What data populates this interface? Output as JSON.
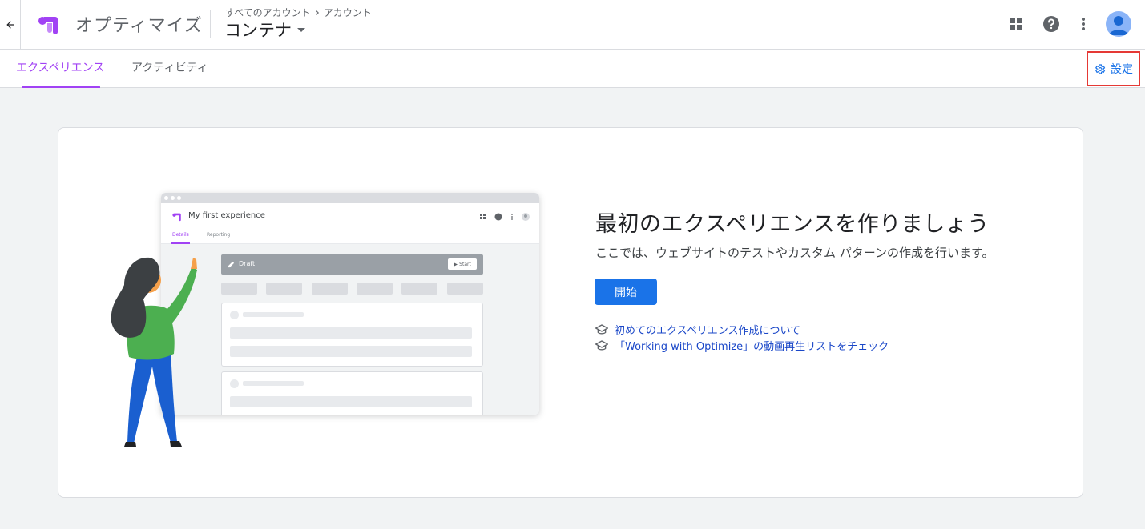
{
  "app": {
    "name": "オプティマイズ",
    "breadcrumb": [
      "すべてのアカウント",
      "アカウント"
    ],
    "container_name": "コンテナ"
  },
  "header_icons": [
    "apps-grid-icon",
    "help-icon",
    "more-vert-icon",
    "account-avatar"
  ],
  "tabs": [
    {
      "label": "エクスペリエンス",
      "active": true
    },
    {
      "label": "アクティビティ",
      "active": false
    }
  ],
  "settings": {
    "label": "設定"
  },
  "illustration": {
    "window_title": "My first experience",
    "tabs": [
      "Details",
      "Reporting"
    ],
    "draft_label": "Draft",
    "start_label": "Start"
  },
  "main": {
    "headline": "最初のエクスペリエンスを作りましょう",
    "subtitle": "ここでは、ウェブサイトのテストやカスタム パターンの作成を行います。",
    "start_button": "開始",
    "links": [
      " 初めてのエクスペリエンス作成について",
      " 「Working with Optimize」の動画再生リストをチェック"
    ]
  },
  "colors": {
    "accent_purple": "#a142f4",
    "primary_blue": "#1a73e8",
    "highlight_red": "#e53935"
  }
}
